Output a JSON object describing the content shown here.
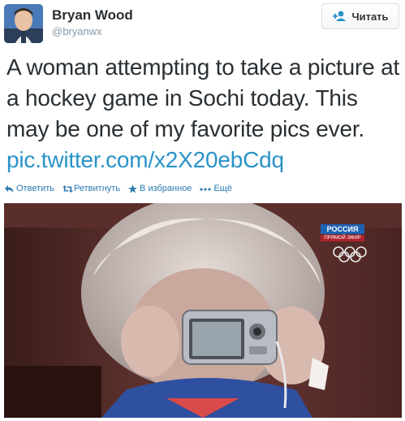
{
  "user": {
    "name": "Bryan Wood",
    "handle": "@bryanwx"
  },
  "follow_button": {
    "label": "Читать"
  },
  "tweet": {
    "text": "A woman attempting to take a picture at a hockey game in Sochi today. This may be one of my favorite pics ever.",
    "link": "pic.twitter.com/x2X20ebCdq"
  },
  "actions": [
    {
      "label": "Ответить",
      "icon": "reply-icon"
    },
    {
      "label": "Ретвитнуть",
      "icon": "retweet-icon"
    },
    {
      "label": "В избранное",
      "icon": "star-icon"
    },
    {
      "label": "Ещё",
      "icon": "more-icon"
    }
  ],
  "photo": {
    "channel_logo": "РОССИЯ",
    "channel_sub": "ПРЯМОЙ ЭФИР"
  },
  "colors": {
    "link": "#2a93c8",
    "action": "#2a7ab0",
    "handle": "#8899a6"
  }
}
